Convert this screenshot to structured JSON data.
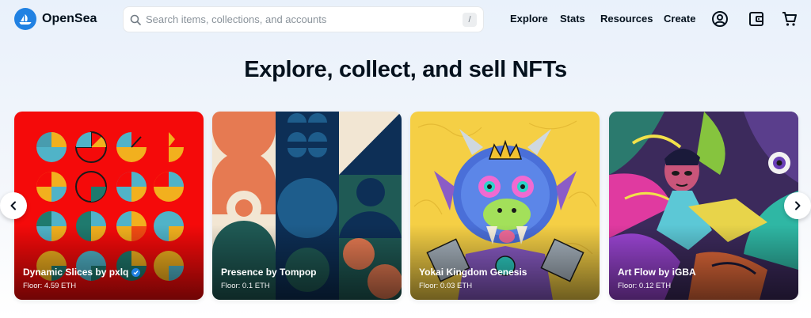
{
  "header": {
    "brand": "OpenSea",
    "search_placeholder": "Search items, collections, and accounts",
    "search_shortcut": "/",
    "nav": [
      "Explore",
      "Stats",
      "Resources",
      "Create"
    ],
    "icons": [
      "account-icon",
      "wallet-icon",
      "cart-icon"
    ]
  },
  "hero": {
    "title": "Explore, collect, and sell NFTs"
  },
  "cards": [
    {
      "name": "Dynamic Slices by pxlq",
      "floor": "Floor: 4.59 ETH",
      "verified": true,
      "bg": "#f50a0a"
    },
    {
      "name": "Presence by Tompop",
      "floor": "Floor: 0.1 ETH",
      "verified": false,
      "bg": "#f2e6d3"
    },
    {
      "name": "Yokai Kingdom Genesis",
      "floor": "Floor: 0.03 ETH",
      "verified": false,
      "bg": "#f5cf45"
    },
    {
      "name": "Art Flow by iGBA",
      "floor": "Floor: 0.12 ETH",
      "verified": false,
      "bg": "#3c2a5c"
    }
  ],
  "colors": {
    "accent": "#2081e2",
    "text": "#04111d"
  }
}
